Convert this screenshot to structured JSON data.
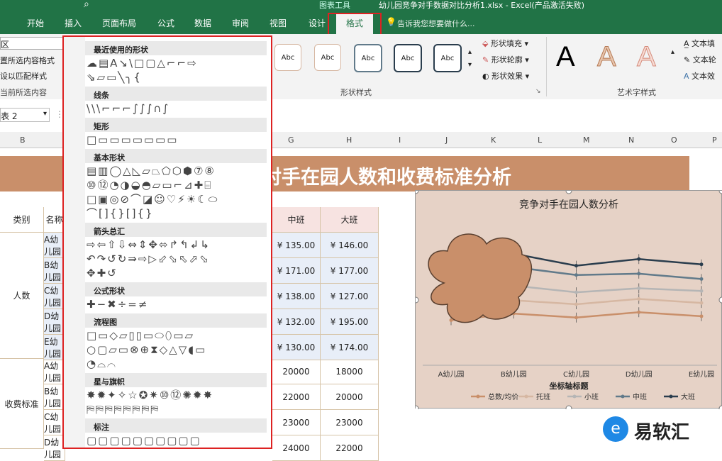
{
  "ribbon": {
    "tool_label": "图表工具",
    "window_title": "幼儿园竞争对手数据对比分析1.xlsx - Excel(产品激活失败)",
    "tabs": [
      "开始",
      "插入",
      "页面布局",
      "公式",
      "数据",
      "审阅",
      "视图",
      "设计",
      "格式"
    ],
    "tell_me": "告诉我您想要做什么...",
    "left_cmds": [
      "置所选内容格式",
      "设以匹配样式",
      "当前所选内容"
    ],
    "shape_styles_label": "Abc",
    "shape_fill": "形状填充",
    "shape_outline": "形状轮廓",
    "shape_effects": "形状效果",
    "group_shape_styles": "形状样式",
    "group_wordart": "艺术字样式",
    "wordart_letter": "A",
    "text_fill": "文本填",
    "text_outline": "文本轮",
    "text_effects": "文本效"
  },
  "formula_bar": {
    "name_box": "表 2"
  },
  "columns": [
    "B",
    "C",
    "G",
    "H",
    "I",
    "J",
    "K",
    "L",
    "M",
    "N",
    "O",
    "P"
  ],
  "sheet": {
    "banner": "对手在园人数和收费标准分析",
    "header": {
      "type": "类别",
      "name": "名称",
      "mid": "中班",
      "big": "大班"
    },
    "group_people": "人数",
    "group_fee": "收费标准",
    "rows_top": [
      {
        "name": "A幼儿园",
        "mid": "¥  135.00",
        "big": "¥  146.00"
      },
      {
        "name": "B幼儿园",
        "mid": "¥  171.00",
        "big": "¥  177.00"
      },
      {
        "name": "C幼儿园",
        "mid": "¥  138.00",
        "big": "¥  127.00"
      },
      {
        "name": "D幼儿园",
        "mid": "¥  132.00",
        "big": "¥  195.00"
      },
      {
        "name": "E幼儿园",
        "mid": "¥  130.00",
        "big": "¥  174.00"
      }
    ],
    "rows_bottom": [
      {
        "name": "A幼儿园",
        "mid": "20000",
        "big": "18000"
      },
      {
        "name": "B幼儿园",
        "mid": "22000",
        "big": "20000"
      },
      {
        "name": "C幼儿园",
        "mid": "23000",
        "big": "23000"
      },
      {
        "name": "D幼儿园",
        "mid": "24000",
        "big": "22000"
      }
    ]
  },
  "shapes_menu": {
    "sections": [
      "最近使用的形状",
      "线条",
      "矩形",
      "基本形状",
      "箭头总汇",
      "公式形状",
      "流程图",
      "星与旗帜",
      "标注"
    ],
    "glyph_rows": [
      "☁▤A↘\\□▢△⌐⌐⇨",
      "⇘▱▭╲╮{",
      "\\\\\\⌐⌐⌐∫∫∫∩∫",
      "□▭▭▭▭▭▭▭",
      "▤▥◯△◺▱⏢⬠⬡⬢⑦⑧",
      "⑩⑫◔◑◒◓▱▭⌐⊿✚⌸",
      "□▣◎⊘⌒◪☺♡⚡☀☾⬭",
      "⌒[]{}[]{}",
      "⇨⇦⇧⇩⇔⇕✥⬄↱↰↲↳",
      "↶↷↺↻⇛⇨▷⬃⬂⬁⬀⬂",
      "✥✚↺",
      "✚−✖÷=≠",
      "□▭◇▱▯▯▭⬭⬯▭▱",
      "○▢▱▭⊗⊕⧗◇△▽◖▭",
      "◔⌓⌒",
      "✸✹✦✧☆✪✷⑩⑫✺✹✸",
      "⛿⛿⛿⛿⛿⛿⛿⛿",
      "▢▢▢▢▢▢▢▢▢▢"
    ]
  },
  "chart_data": {
    "type": "line",
    "title": "竞争对手在园人数分析",
    "xlabel": "坐标轴标题",
    "ylabel": "",
    "categories": [
      "A幼儿园",
      "B幼儿园",
      "C幼儿园",
      "D幼儿园",
      "E幼儿园"
    ],
    "series": [
      {
        "name": "总数/均价",
        "color": "#c98f6a",
        "values": [
          130,
          135,
          132,
          136,
          133
        ]
      },
      {
        "name": "托班",
        "color": "#d6b7a2",
        "values": [
          140,
          145,
          142,
          146,
          143
        ]
      },
      {
        "name": "小班",
        "color": "#b5b5b5",
        "values": [
          150,
          156,
          151,
          154,
          152
        ]
      },
      {
        "name": "中班",
        "color": "#617a8a",
        "values": [
          163,
          170,
          164,
          165,
          161
        ]
      },
      {
        "name": "大班",
        "color": "#2a3d4d",
        "values": [
          175,
          180,
          171,
          176,
          172
        ]
      }
    ],
    "ylim": [
      110,
      190
    ],
    "grid": false,
    "legend": "bottom"
  },
  "watermark": {
    "text": "易软汇"
  }
}
